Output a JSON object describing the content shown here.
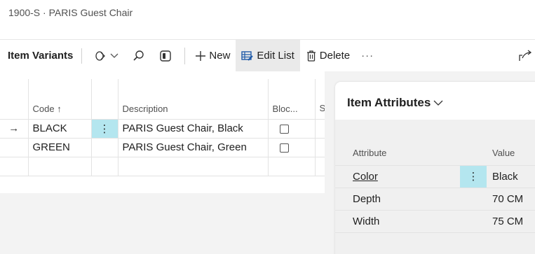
{
  "breadcrumb": "1900-S · PARIS Guest Chair",
  "toolbar": {
    "title": "Item Variants",
    "new_label": "New",
    "edit_list_label": "Edit List",
    "delete_label": "Delete",
    "more_label": "···"
  },
  "grid": {
    "headers": {
      "code": "Code ↑",
      "description": "Description",
      "blocked": "Bloc...",
      "extra": "S B"
    },
    "rows": [
      {
        "code": "BLACK",
        "description": "PARIS Guest Chair, Black",
        "blocked": false,
        "current": true
      },
      {
        "code": "GREEN",
        "description": "PARIS Guest Chair, Green",
        "blocked": false,
        "current": false
      }
    ]
  },
  "attributes": {
    "title": "Item Attributes",
    "headers": {
      "attribute": "Attribute",
      "value": "Value"
    },
    "rows": [
      {
        "attribute": "Color",
        "value": "Black"
      },
      {
        "attribute": "Depth",
        "value": "70 CM"
      },
      {
        "attribute": "Width",
        "value": "75 CM"
      }
    ]
  },
  "colors": {
    "selection": "#b4e6ef",
    "toolbar_active": "#eaeaea"
  }
}
